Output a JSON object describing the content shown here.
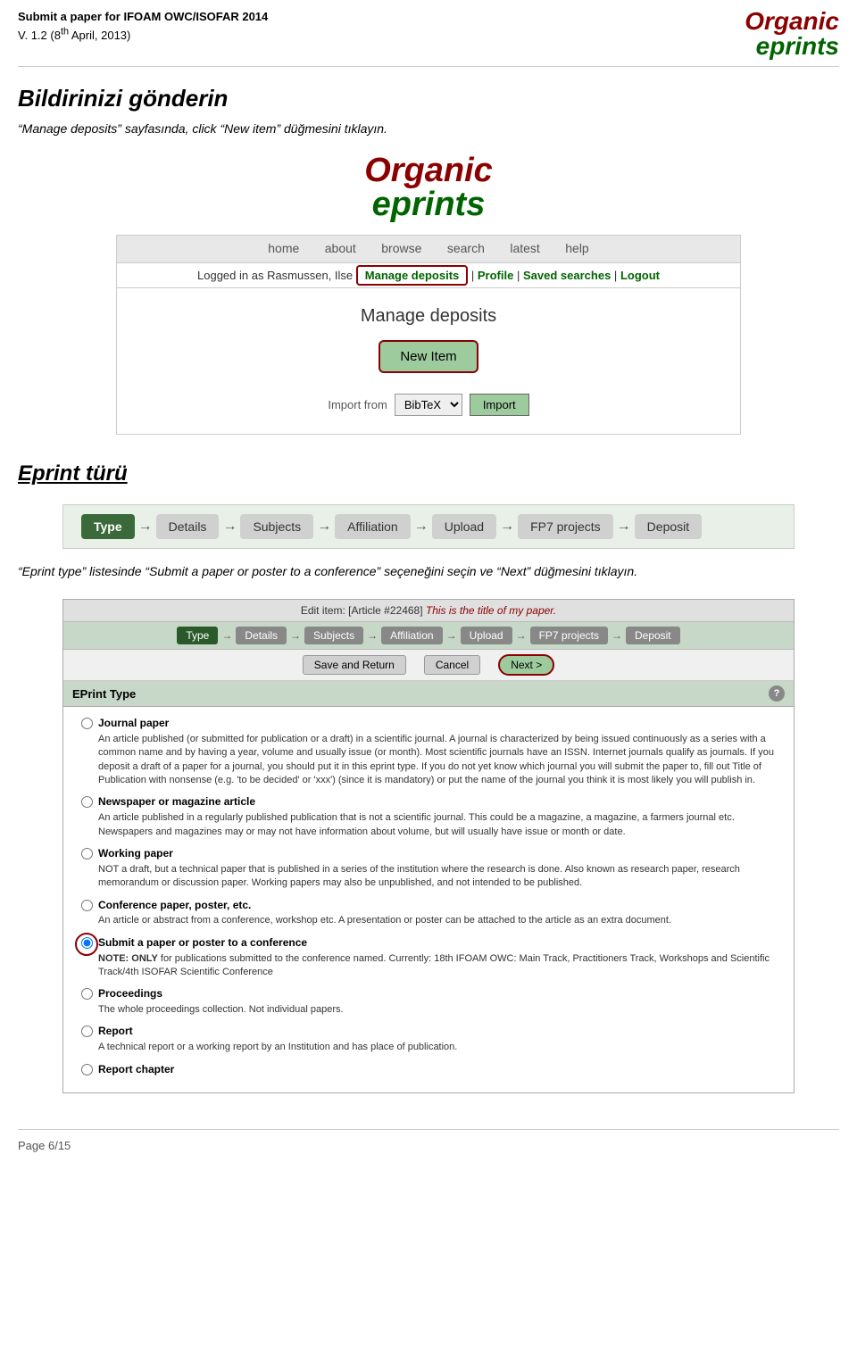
{
  "header": {
    "title_line1": "Submit a paper for IFOAM OWC/ISOFAR 2014",
    "title_line2": "V. 1.2 (8",
    "title_line2_super": "th",
    "title_line2_end": " April, 2013)",
    "logo_organic": "Organic",
    "logo_eprints": "eprints"
  },
  "section1": {
    "title": "Bildirinizi gönderin",
    "desc": "“Manage deposits” sayfasında, click “New item” düğmesini tıklayın."
  },
  "center_logo": {
    "organic": "Organic",
    "eprints": "eprints"
  },
  "nav": {
    "items": [
      "home",
      "about",
      "browse",
      "search",
      "latest",
      "help"
    ]
  },
  "user_bar": {
    "logged_in_text": "Logged in as Rasmussen, Ilse",
    "manage_deposits": "Manage deposits",
    "profile": "Profile",
    "saved_searches": "Saved searches",
    "logout": "Logout",
    "separator": "|"
  },
  "manage_deposits": {
    "title": "Manage deposits",
    "new_item_label": "New Item",
    "import_label": "Import from",
    "import_option": "BibTeX",
    "import_button": "Import"
  },
  "section2": {
    "title": "Eprint türü",
    "desc": "“Eprint type” listesinde “Submit a paper or poster to a conference” seçeneğini seçin ve “Next” düğmesini tıklayın."
  },
  "workflow1": {
    "steps": [
      "Type",
      "Details",
      "Subjects",
      "Affiliation",
      "Upload",
      "FP7 projects",
      "Deposit"
    ]
  },
  "edit_item": {
    "title": "Edit item: [Article #22468]",
    "subtitle": "This is the title of my paper."
  },
  "workflow2": {
    "steps": [
      "Type",
      "Details",
      "Subjects",
      "Affiliation",
      "Upload",
      "FP7 projects",
      "Deposit"
    ]
  },
  "actions": {
    "save_return": "Save and Return",
    "cancel": "Cancel",
    "next": "Next >"
  },
  "eprint_type_section": {
    "label": "EPrint Type",
    "options": [
      {
        "label": "Journal paper",
        "desc": "An article published (or submitted for publication or a draft) in a scientific journal. A journal is characterized by being issued continuously as a series with a common name and by having a year, volume and usually issue (or month). Most scientific journals have an ISSN. Internet journals qualify as journals. If you deposit a draft of a paper for a journal, you should put it in this eprint type. If you do not yet know which journal you will submit the paper to, fill out Title of Publication with nonsense (e.g. 'to be decided' or 'xxx') (since it is mandatory) or put the name of the journal you think it is most likely you will publish in.",
        "selected": false
      },
      {
        "label": "Newspaper or magazine article",
        "desc": "An article published in a regularly published publication that is not a scientific journal. This could be a magazine, a magazine, a farmers journal etc. Newspapers and magazines may or may not have information about volume, but will usually have issue or month or date.",
        "selected": false
      },
      {
        "label": "Working paper",
        "desc": "NOT a draft, but a technical paper that is published in a series of the institution where the research is done. Also known as research paper, research memorandum or discussion paper. Working papers may also be unpublished, and not intended to be published.",
        "selected": false
      },
      {
        "label": "Conference paper, poster, etc.",
        "desc": "An article or abstract from a conference, workshop etc. A presentation or poster can be attached to the article as an extra document.",
        "selected": false
      },
      {
        "label": "Submit a paper or poster to a conference",
        "desc": "NOTE: ONLY for publications submitted to the conference named. Currently: 18th IFOAM OWC: Main Track, Practitioners Track, Workshops and Scientific Track/4th ISOFAR Scientific Conference",
        "selected": true,
        "highlighted": true
      },
      {
        "label": "Proceedings",
        "desc": "The whole proceedings collection. Not individual papers.",
        "selected": false
      },
      {
        "label": "Report",
        "desc": "A technical report or a working report by an Institution and has place of publication.",
        "selected": false
      },
      {
        "label": "Report chapter",
        "desc": "",
        "selected": false
      }
    ]
  },
  "footer": {
    "page_label": "Page 6/15"
  }
}
